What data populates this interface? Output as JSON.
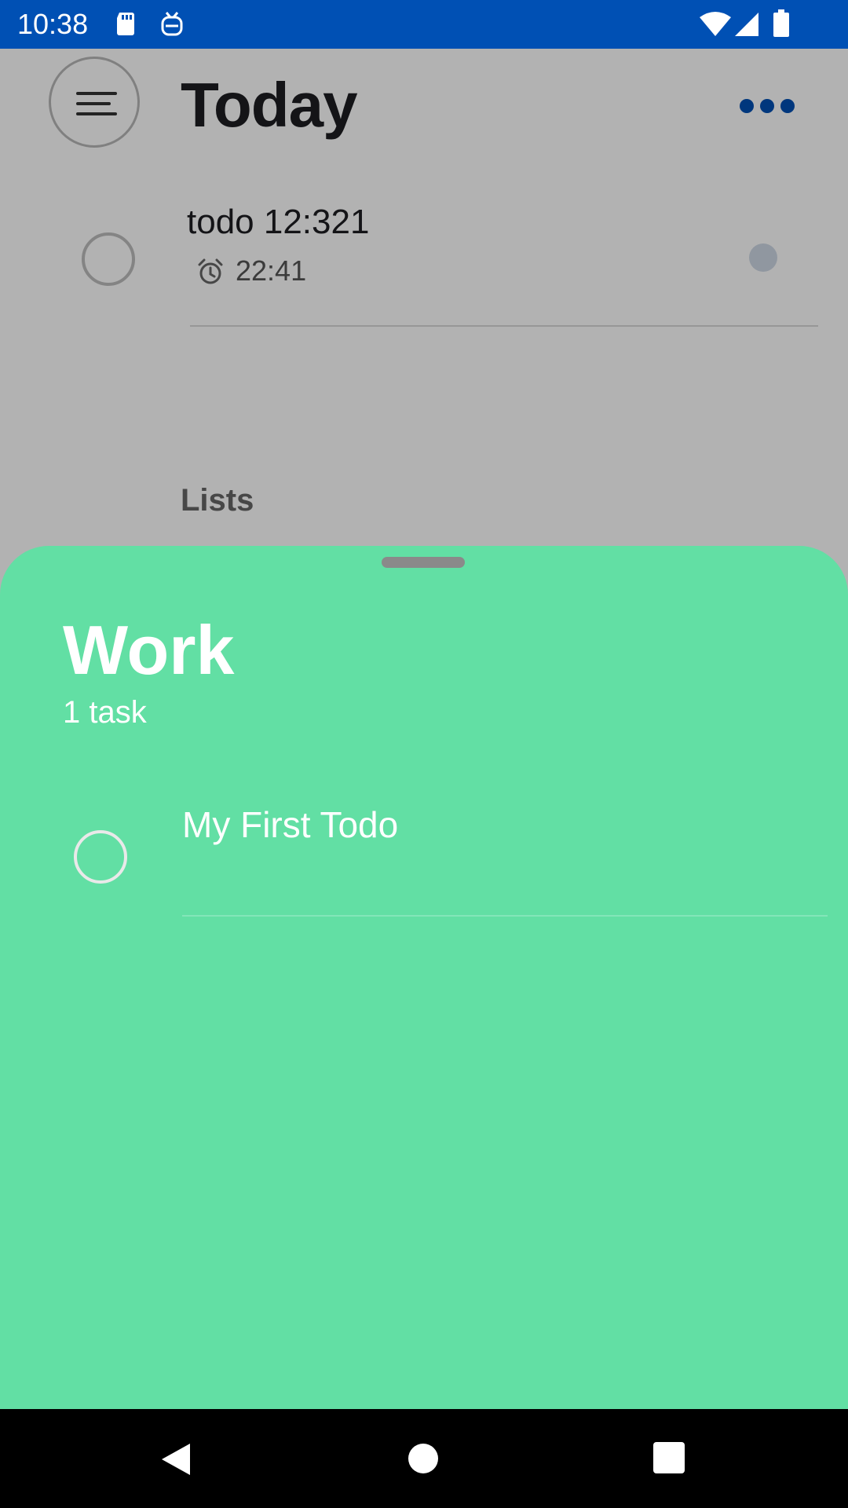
{
  "status_bar": {
    "time": "10:38",
    "icons": [
      "sd-card-icon",
      "tv-icon",
      "wifi-icon",
      "signal-icon",
      "battery-icon"
    ]
  },
  "header": {
    "title": "Today",
    "menu_icon": "menu-icon",
    "more_icon": "more-dots-icon"
  },
  "today_tasks": [
    {
      "title": "todo 12:321",
      "reminder_time": "22:41"
    }
  ],
  "lists_section": {
    "heading": "Lists"
  },
  "sheet": {
    "title": "Work",
    "count": "1 task",
    "items": [
      {
        "title": "My First Todo"
      }
    ]
  },
  "colors": {
    "status_bar": "#0050b4",
    "accent": "#0050b4",
    "sheet_background": "#62dfa4",
    "nav_bar": "#000000"
  }
}
